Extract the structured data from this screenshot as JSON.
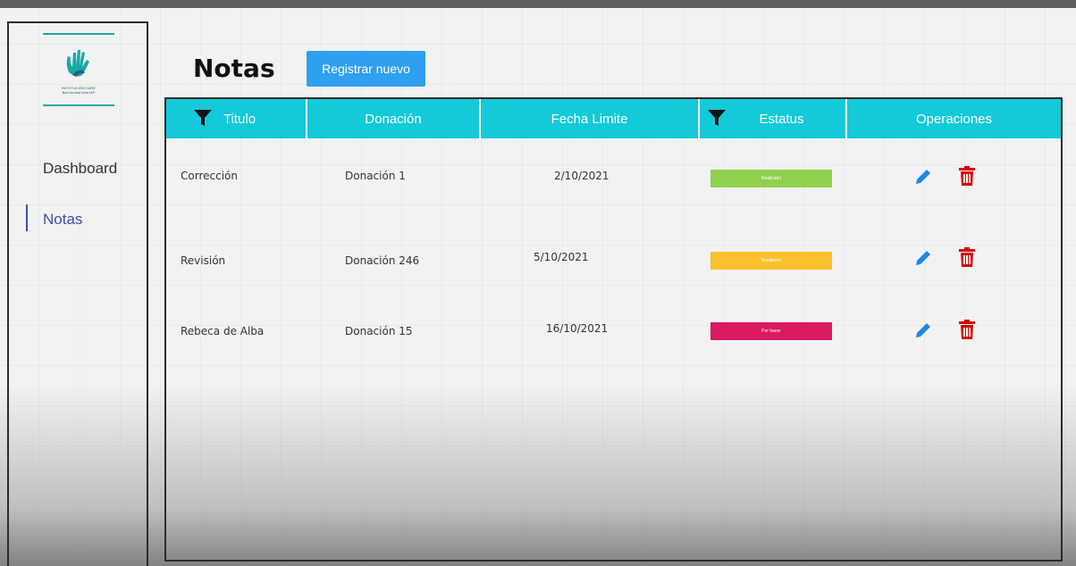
{
  "sidebar": {
    "logo_text_line1": "INSTITUCIÓN CARE",
    "logo_text_line2": "Bad Acosta Vida IAP",
    "items": [
      {
        "label": "Dashboard",
        "active": false
      },
      {
        "label": "Notas",
        "active": true
      }
    ]
  },
  "page": {
    "title": "Notas",
    "new_button_label": "Registrar nuevo"
  },
  "table": {
    "columns": [
      "Titulo",
      "Donación",
      "Fecha Limite",
      "Estatus",
      "Operaciones"
    ],
    "rows": [
      {
        "titulo": "Corrección",
        "donacion": "Donación 1",
        "fecha": "2/10/2021",
        "estatus": "Realizado",
        "estatus_color": "#8fd14f"
      },
      {
        "titulo": "Revisión",
        "donacion": "Donación 246",
        "fecha": "5/10/2021",
        "estatus": "Pendiente",
        "estatus_color": "#fbc02d"
      },
      {
        "titulo": "Rebeca de Alba",
        "donacion": "Donación 15",
        "fecha": "16/10/2021",
        "estatus": "Por hacer",
        "estatus_color": "#d81b60"
      }
    ]
  },
  "colors": {
    "accent": "#14c9d8",
    "button": "#2f9ff0",
    "edit_icon": "#1e88e5",
    "delete_icon": "#d50000",
    "logo": "#18a9a6"
  },
  "icons": {
    "filter": "filter-icon",
    "edit": "pencil-icon",
    "delete": "trash-icon"
  }
}
